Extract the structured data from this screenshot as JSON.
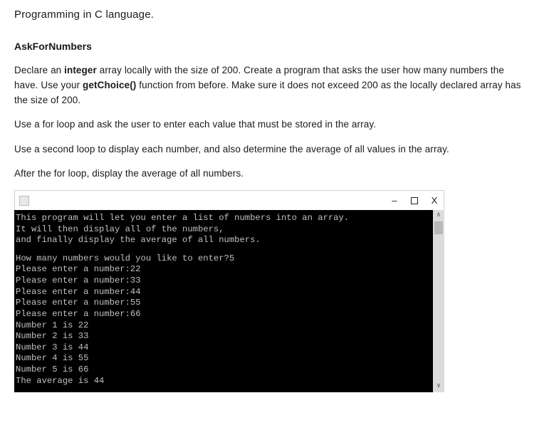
{
  "page": {
    "title": "Programming in C language."
  },
  "section": {
    "heading": "AskForNumbers",
    "p1_a": "Declare an ",
    "p1_kw1": "integer",
    "p1_b": " array locally with the size of 200. Create a program that asks the user how many numbers the have. Use your ",
    "p1_kw2": "getChoice()",
    "p1_c": " function from before. Make sure it does not exceed 200 as the locally declared array has the size of 200.",
    "p2": "Use a for loop and ask the user to enter each value that must be stored in the array.",
    "p3": "Use a second loop to display each number, and also determine the average of all values in the array.",
    "p4": "After the for loop, display the average of all numbers."
  },
  "window": {
    "minimize": "–",
    "close": "X"
  },
  "terminal": {
    "intro1": "This program will let you enter a list of numbers into an array.",
    "intro2": "It will then display all of the numbers,",
    "intro3": "and finally display the average of all numbers.",
    "lines": [
      "How many numbers would you like to enter?5",
      "Please enter a number:22",
      "Please enter a number:33",
      "Please enter a number:44",
      "Please enter a number:55",
      "Please enter a number:66",
      "Number 1 is 22",
      "Number 2 is 33",
      "Number 3 is 44",
      "Number 4 is 55",
      "Number 5 is 66",
      "The average is 44"
    ]
  }
}
